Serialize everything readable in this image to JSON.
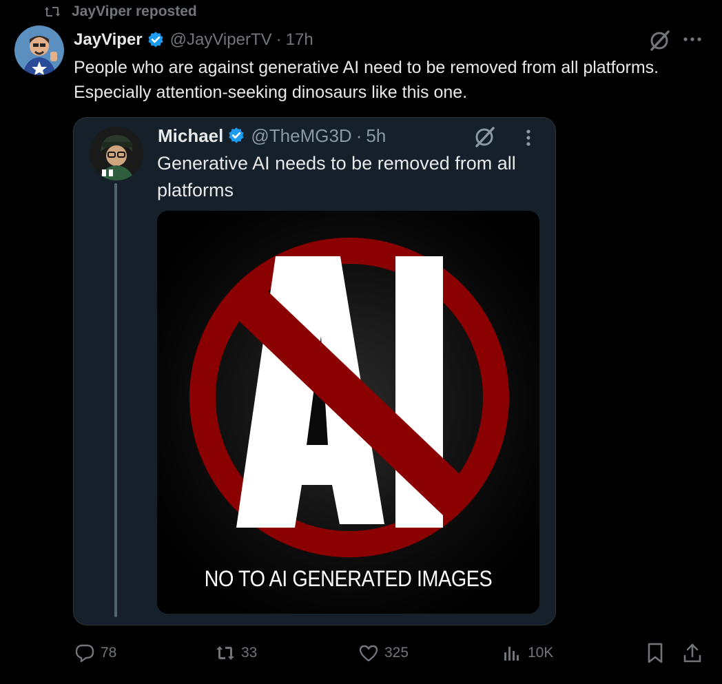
{
  "repost_header": {
    "text": "JayViper reposted"
  },
  "post": {
    "author_name": "JayViper",
    "handle": "@JayViperTV",
    "separator": "·",
    "time": "17h",
    "text": "People who are against generative AI need to be removed from all platforms. Especially attention-seeking dinosaurs like this one."
  },
  "quote": {
    "author_name": "Michael",
    "handle": "@TheMG3D",
    "separator": "·",
    "time": "5h",
    "text": "Generative AI needs to be removed from all platforms",
    "media": {
      "glyph_text": "AI",
      "caption": "NO TO AI GENERATED IMAGES",
      "prohibition_color": "#8b0000"
    }
  },
  "actions": {
    "replies": "78",
    "reposts": "33",
    "likes": "325",
    "views": "10K"
  },
  "colors": {
    "background": "#000000",
    "text_primary": "#e7e9ea",
    "text_secondary": "#71767b",
    "verified_blue": "#1d9bf0",
    "card_bg": "#15202b"
  },
  "icons": [
    "repost-icon",
    "verified-badge-icon",
    "grok-icon",
    "more-icon",
    "reply-icon",
    "like-icon",
    "views-icon",
    "bookmark-icon",
    "share-icon"
  ]
}
